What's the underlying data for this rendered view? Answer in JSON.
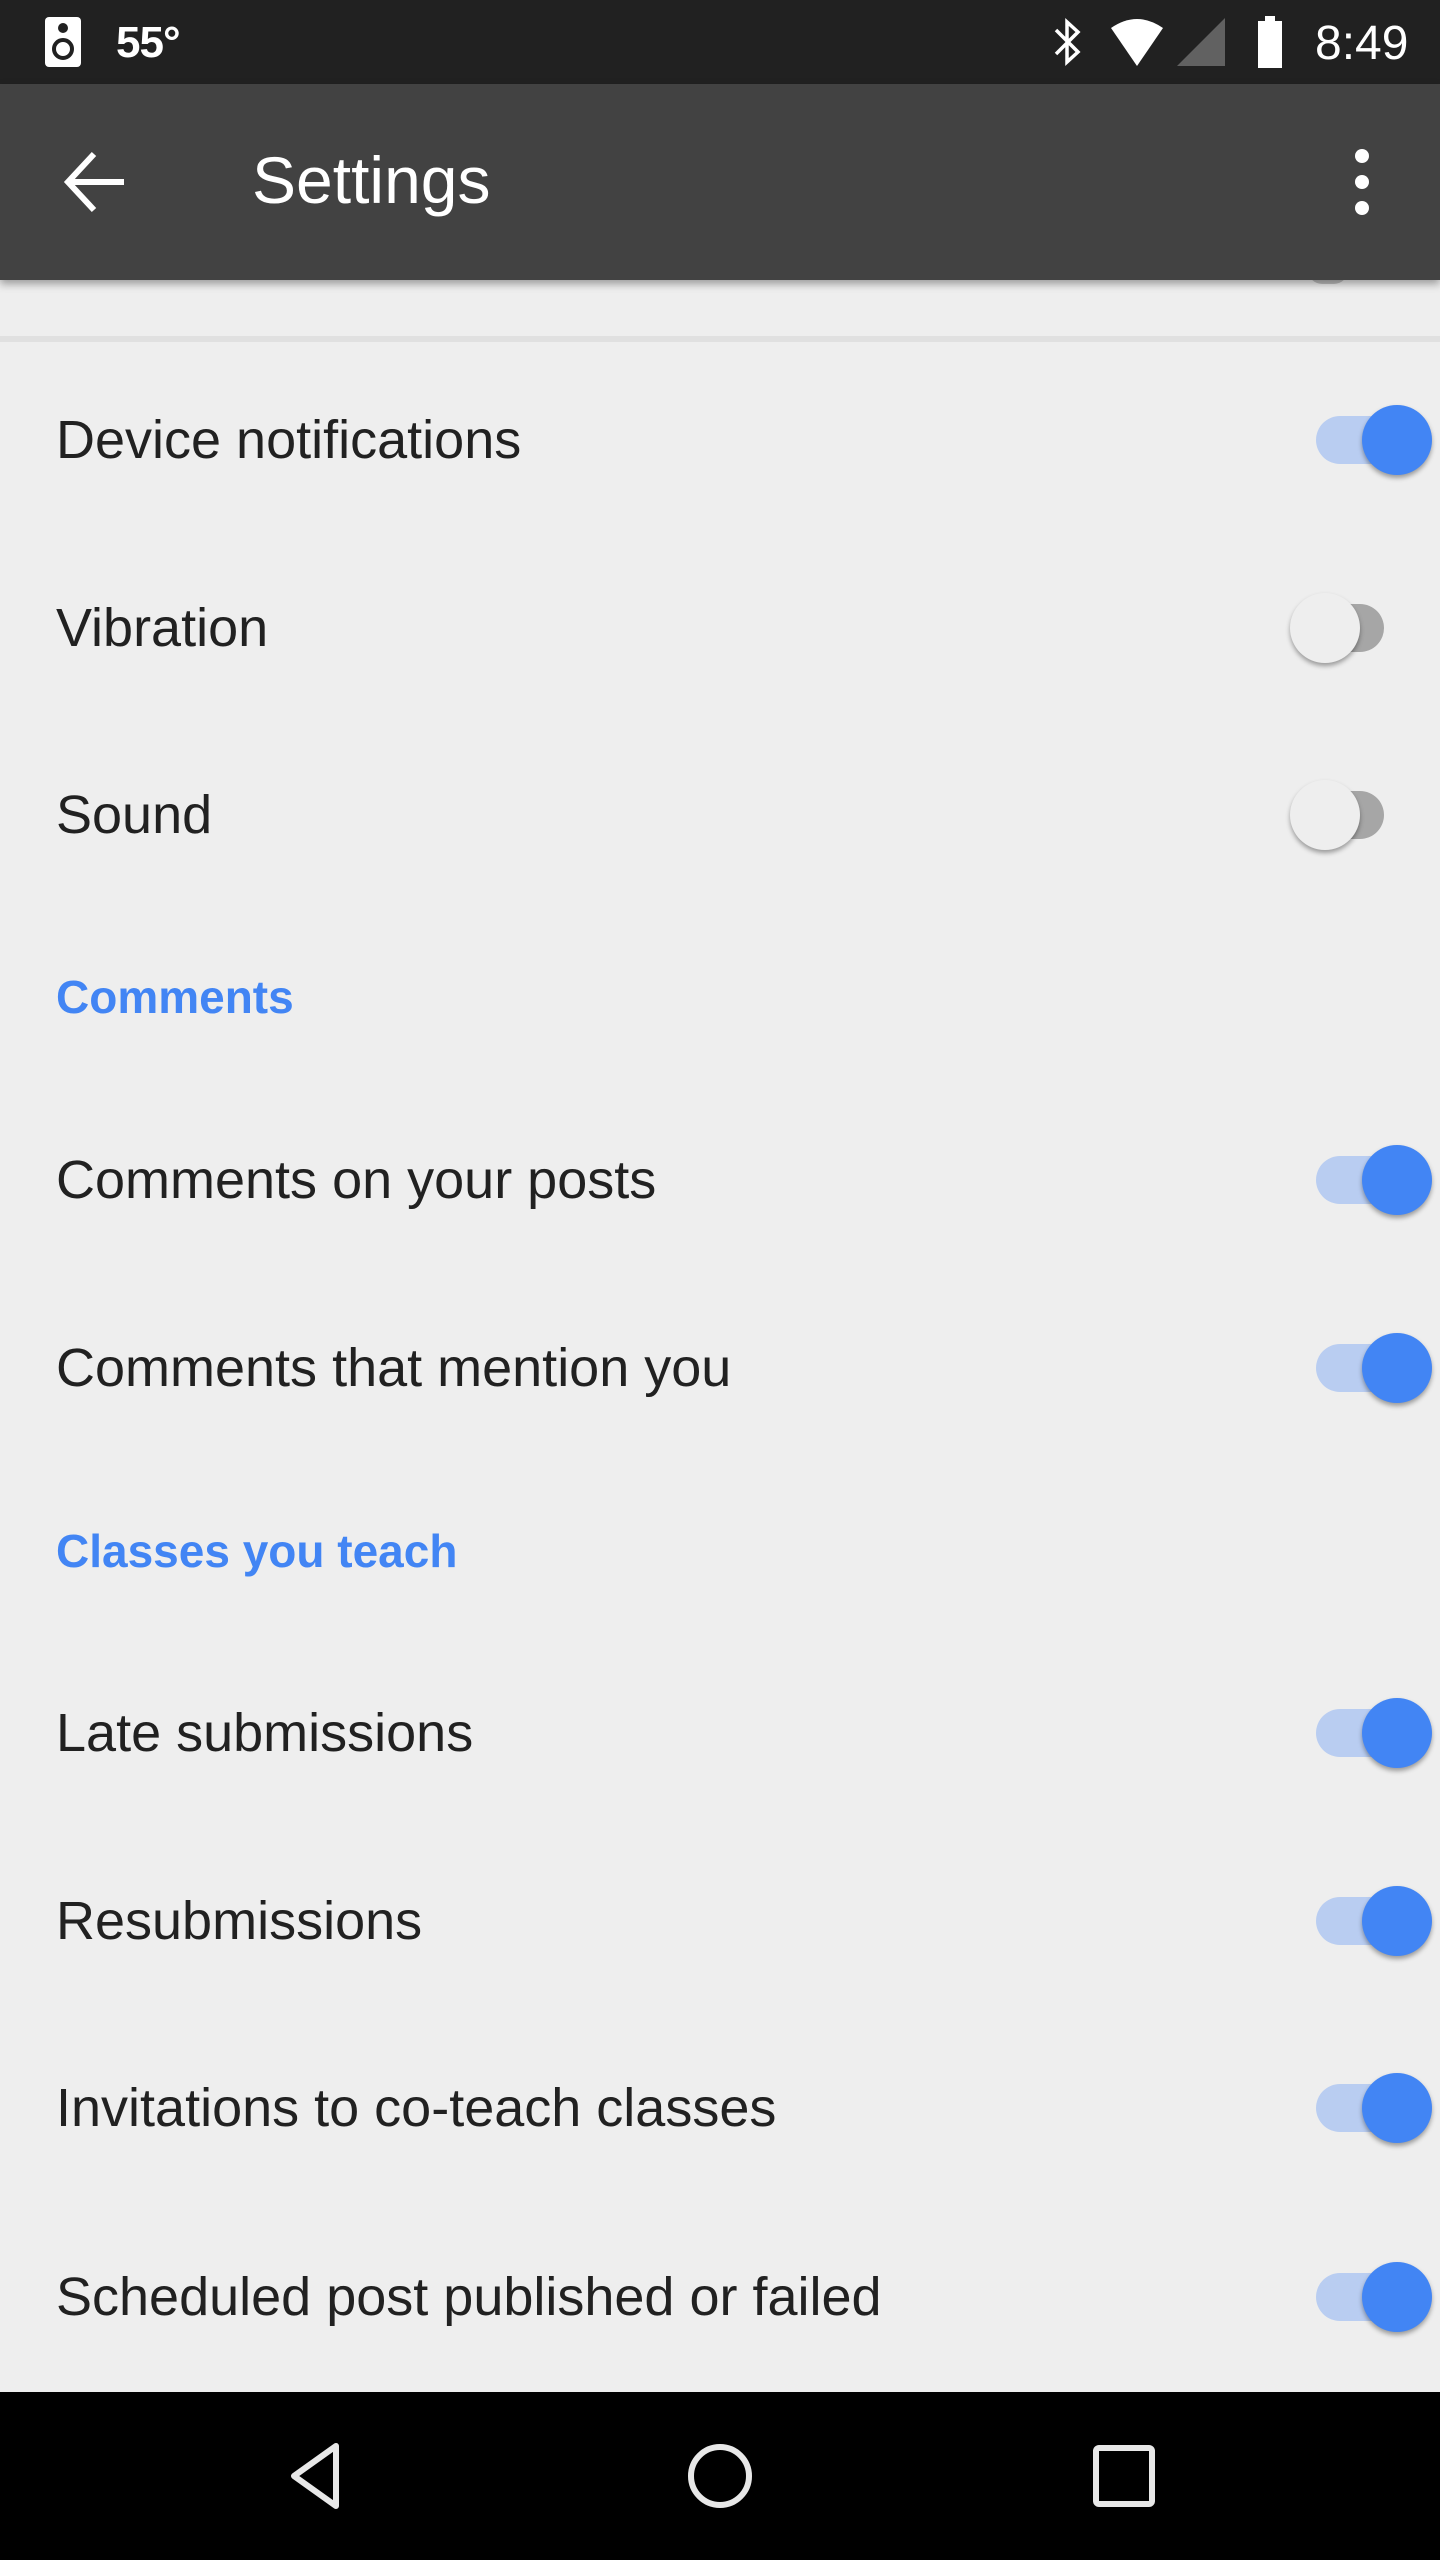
{
  "status_bar": {
    "left_icon": "speaker-icon",
    "temperature": "55°",
    "icons": [
      "bluetooth-icon",
      "wifi-icon",
      "signal-icon",
      "battery-icon"
    ],
    "time": "8:49"
  },
  "toolbar": {
    "back_icon": "arrow-back-icon",
    "title": "Settings",
    "more_icon": "more-vert-icon"
  },
  "general": {
    "items": [
      {
        "label": "Device notifications",
        "enabled": true
      },
      {
        "label": "Vibration",
        "enabled": false
      },
      {
        "label": "Sound",
        "enabled": false
      }
    ]
  },
  "comments": {
    "header": "Comments",
    "items": [
      {
        "label": "Comments on your posts",
        "enabled": true
      },
      {
        "label": "Comments that mention you",
        "enabled": true
      }
    ]
  },
  "classes_you_teach": {
    "header": "Classes you teach",
    "items": [
      {
        "label": "Late submissions",
        "enabled": true
      },
      {
        "label": "Resubmissions",
        "enabled": true
      },
      {
        "label": "Invitations to co-teach classes",
        "enabled": true
      },
      {
        "label": "Scheduled post published or failed",
        "enabled": true
      }
    ]
  },
  "nav_bar": {
    "buttons": [
      "nav-back-icon",
      "nav-home-icon",
      "nav-recents-icon"
    ]
  },
  "colors": {
    "accent": "#4285f4",
    "switch_track_on": "#b9cdf1",
    "switch_track_off": "#a6a6a6",
    "toolbar": "#424242",
    "status_bar": "#212121",
    "background": "#eeeeee"
  }
}
